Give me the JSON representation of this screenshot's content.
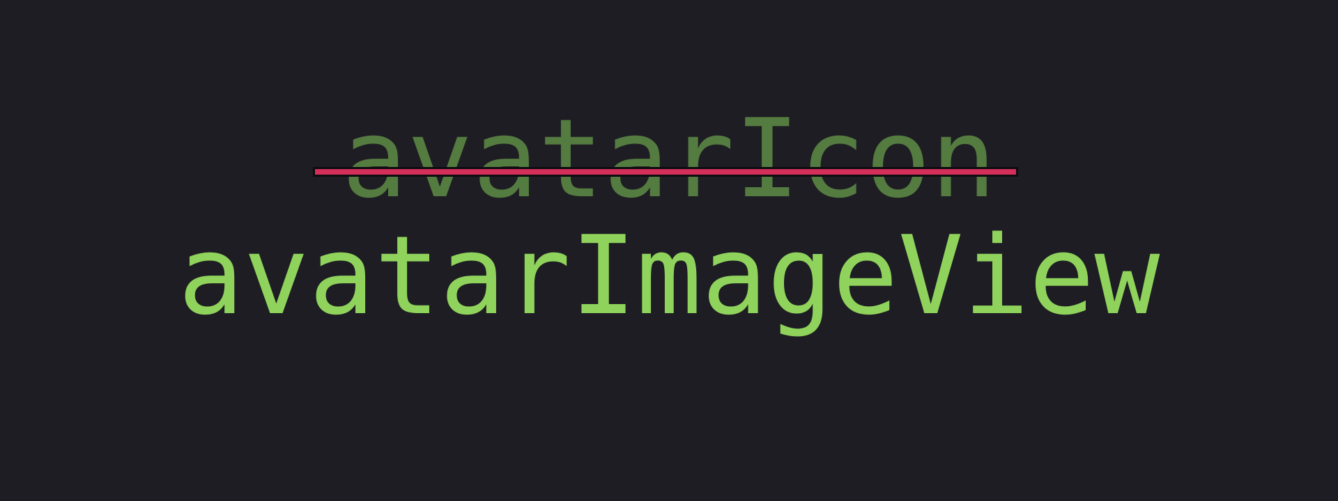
{
  "rename": {
    "old_name": "avatarIcon",
    "new_name": "avatarImageView"
  },
  "colors": {
    "background": "#1e1d23",
    "old_name": "#547b40",
    "new_name": "#8fd35c",
    "strikethrough": "#d42f5a"
  }
}
